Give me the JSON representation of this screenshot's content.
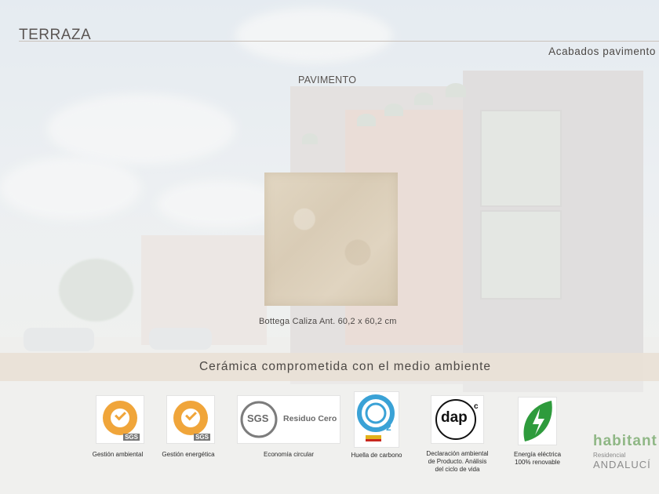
{
  "header": {
    "title": "TERRAZA",
    "finishes_label": "Acabados pavimento"
  },
  "section": {
    "heading": "PAVIMENTO"
  },
  "swatch": {
    "caption": "Bottega Caliza Ant. 60,2 x 60,2 cm"
  },
  "eco": {
    "banner": "Cerámica comprometida con el medio ambiente"
  },
  "certifications": [
    {
      "label": "Gestión ambiental",
      "mark": "SGS"
    },
    {
      "label": "Gestión energética",
      "mark": "SGS"
    },
    {
      "label": "Economía circular",
      "mark": "SGS",
      "logo_text": "Residuo Cero"
    },
    {
      "label": "Huella de carbono",
      "logo_text": "2"
    },
    {
      "label_line1": "Declaración ambiental",
      "label_line2": "de Producto. Análisis",
      "label_line3": "del ciclo de vida",
      "logo_text": "dap",
      "logo_sup": "c"
    },
    {
      "label_line1": "Energía eléctrica",
      "label_line2": "100% renovable"
    }
  ],
  "brand": {
    "name": "habitant",
    "place": "ANDALUCÍ",
    "sub": "Residencial"
  },
  "colors": {
    "banner": "#e9e1d6",
    "swatch": "#ddd1bc",
    "seal_orange": "#f0a53a",
    "leaf_green": "#2e9b3c",
    "co2_blue": "#3aa2d6"
  }
}
